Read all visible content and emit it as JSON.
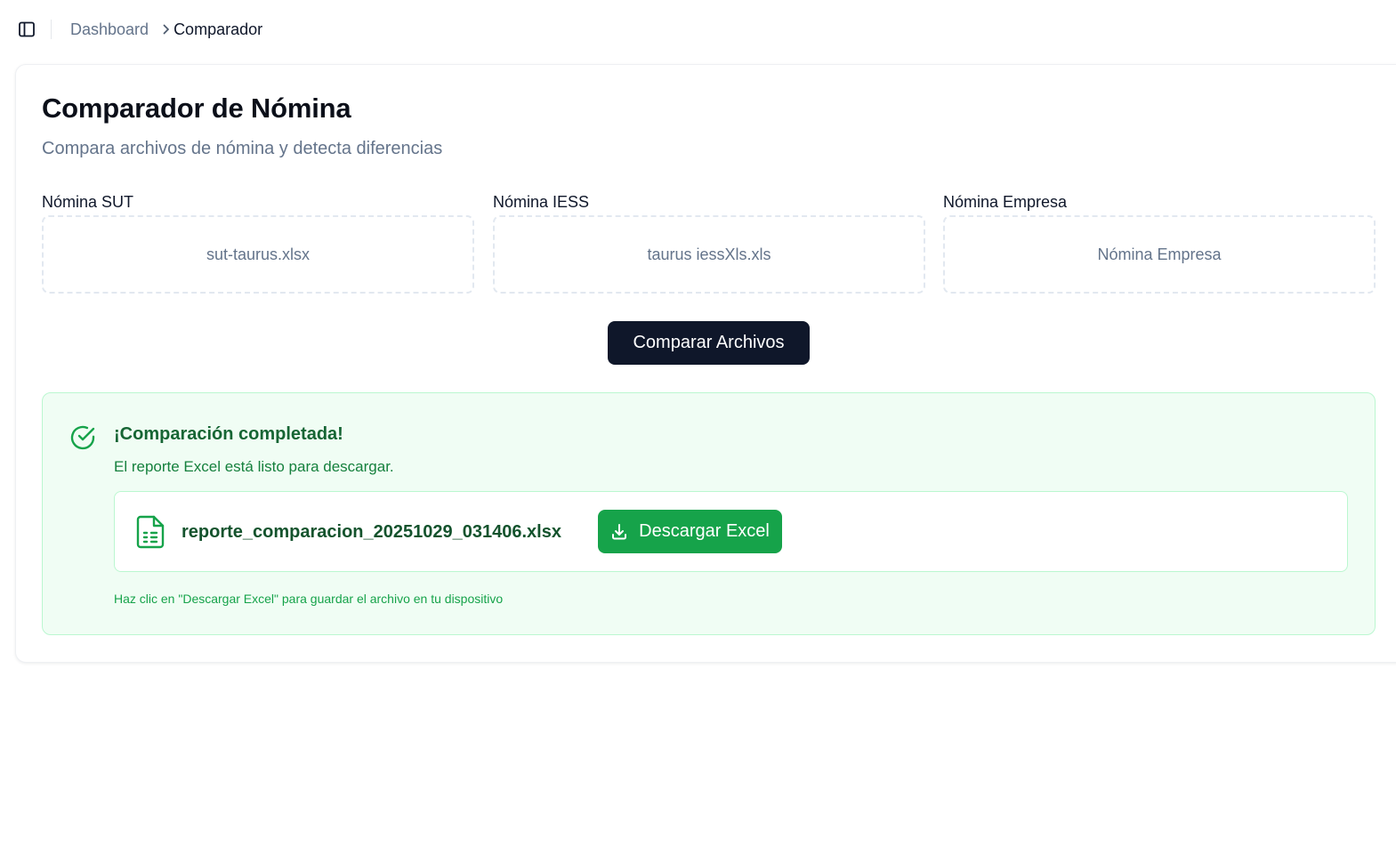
{
  "header": {
    "sidebar_toggle_icon": "panel-left-icon",
    "breadcrumb": {
      "root": "Dashboard",
      "separator_icon": "chevron-right-icon",
      "current": "Comparador"
    }
  },
  "page": {
    "title": "Comparador de Nómina",
    "subtitle": "Compara archivos de nómina y detecta diferencias"
  },
  "uploads": [
    {
      "label": "Nómina SUT",
      "value": "sut-taurus.xlsx"
    },
    {
      "label": "Nómina IESS",
      "value": "taurus iessXls.xls"
    },
    {
      "label": "Nómina Empresa",
      "value": "Nómina Empresa"
    }
  ],
  "compare_button": {
    "label": "Comparar Archivos"
  },
  "result": {
    "status_icon": "check-circle-icon",
    "title": "¡Comparación completada!",
    "description": "El reporte Excel está listo para descargar.",
    "file": {
      "icon": "file-spreadsheet-icon",
      "name": "reporte_comparacion_20251029_031406.xlsx"
    },
    "download_button": {
      "icon": "download-icon",
      "label": "Descargar Excel"
    },
    "hint": "Haz clic en \"Descargar Excel\" para guardar el archivo en tu dispositivo"
  },
  "colors": {
    "primary_dark": "#0f172a",
    "success": "#16a34a",
    "success_bg": "#f0fdf4",
    "muted": "#64748b"
  }
}
